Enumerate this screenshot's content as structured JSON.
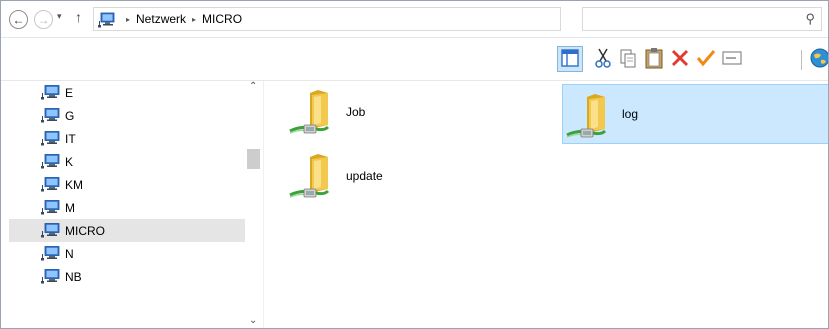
{
  "window": {
    "address": {
      "crumbs": [
        "Netzwerk",
        "MICRO"
      ],
      "separator_glyph": "▸"
    },
    "search": {
      "placeholder": ""
    },
    "icons": {
      "back": "back-arrow-icon",
      "forward": "forward-arrow-icon",
      "recent": "chevron-down-icon",
      "up": "up-arrow-icon",
      "refresh": "refresh-icon",
      "search": "search-icon"
    },
    "glyphs": {
      "back": "←",
      "forward": "→",
      "recent": "▾",
      "up": "↑",
      "dropdown": "⌄",
      "refresh": "↻",
      "search": "⚲",
      "scroll_up": "⌃",
      "scroll_down": "⌄"
    }
  },
  "toolbar": {
    "buttons": [
      {
        "name": "layout-pane-icon",
        "active": true
      },
      {
        "name": "cut-icon"
      },
      {
        "name": "copy-icon"
      },
      {
        "name": "paste-icon"
      },
      {
        "name": "delete-icon"
      },
      {
        "name": "checkmark-icon"
      },
      {
        "name": "rename-icon"
      },
      {
        "name": "globe-icon"
      }
    ],
    "colors": {
      "delete": "#e23b2e",
      "check": "#f08a14",
      "active_bg": "#cde6f7"
    }
  },
  "sidebar": {
    "items": [
      {
        "label": "E"
      },
      {
        "label": "G"
      },
      {
        "label": "IT"
      },
      {
        "label": "K"
      },
      {
        "label": "KM"
      },
      {
        "label": "M"
      },
      {
        "label": "MICRO",
        "selected": true
      },
      {
        "label": "N"
      },
      {
        "label": "NB"
      }
    ],
    "item_icon": "network-computer-icon"
  },
  "content": {
    "items": [
      {
        "label": "Job"
      },
      {
        "label": "update"
      },
      {
        "label": "log",
        "selected": true
      }
    ],
    "item_icon": "network-share-folder-icon",
    "colors": {
      "folder": "#f2c94c",
      "folder_dark": "#d9a91f",
      "cable": "#3aa23a",
      "selected_bg": "#cce8ff"
    }
  }
}
